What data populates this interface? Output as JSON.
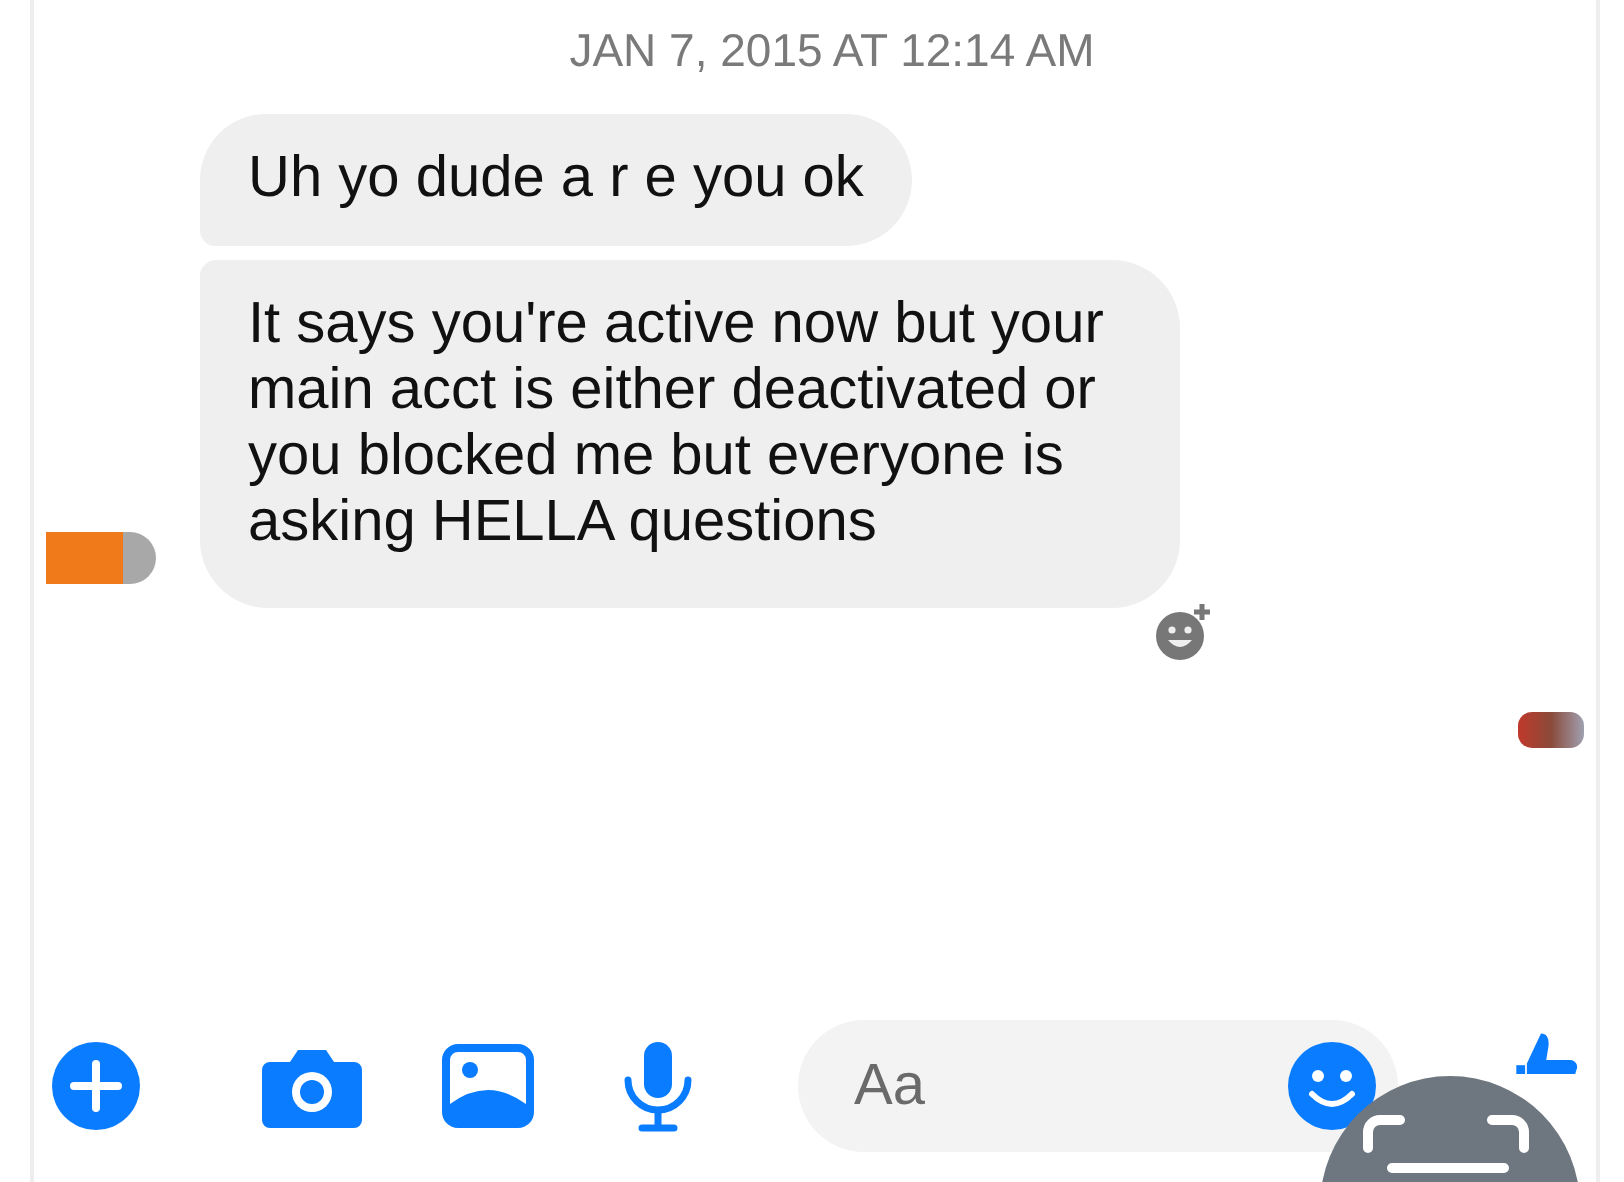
{
  "timestamp": "JAN 7, 2015 AT 12:14 AM",
  "messages": [
    {
      "text": "Uh yo dude a r e you ok"
    },
    {
      "text": "It says you're active now but your main acct is either deactivated or you blocked me but everyone is asking HELLA questions"
    }
  ],
  "composer": {
    "placeholder": "Aa"
  }
}
